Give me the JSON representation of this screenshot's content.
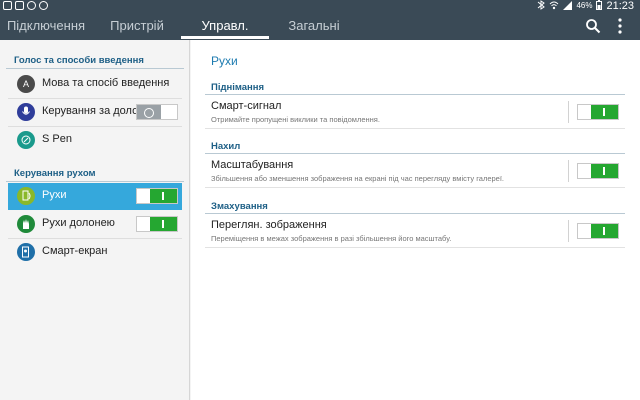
{
  "status_bar": {
    "battery": "46%",
    "time": "21:23"
  },
  "tabs": [
    {
      "label": "Підключення"
    },
    {
      "label": "Пристрій"
    },
    {
      "label": "Управл."
    },
    {
      "label": "Загальні"
    }
  ],
  "active_tab": "Управл.",
  "left_panel": {
    "section1": {
      "header": "Голос та способи введення",
      "items": [
        {
          "label": "Мова та спосіб введення",
          "icon": "keyboard-icon"
        },
        {
          "label": "Керування за долонею",
          "icon": "microphone-icon",
          "toggle": "off"
        },
        {
          "label": "S Pen",
          "icon": "s-pen-icon"
        }
      ]
    },
    "section2": {
      "header": "Керування рухом",
      "items": [
        {
          "label": "Рухи",
          "icon": "motion-icon",
          "toggle": "on",
          "selected": true
        },
        {
          "label": "Рухи долонею",
          "icon": "palm-icon",
          "toggle": "on"
        },
        {
          "label": "Смарт-екран",
          "icon": "smart-screen-icon"
        }
      ]
    }
  },
  "right_panel": {
    "title": "Рухи",
    "sections": [
      {
        "header": "Піднімання",
        "item_title": "Смарт-сигнал",
        "item_sub": "Отримайте пропущені виклики та повідомлення.",
        "toggle": "on"
      },
      {
        "header": "Нахил",
        "item_title": "Масштабування",
        "item_sub": "Збільшення або зменшення зображення на екрані під час перегляду вмісту галереї.",
        "toggle": "on"
      },
      {
        "header": "Змахування",
        "item_title": "Переглян. зображення",
        "item_sub": "Переміщення в межах зображення в разі збільшення його масштабу.",
        "toggle": "on"
      }
    ]
  },
  "colors": {
    "bar": "#3a4a56",
    "accent": "#35a8dc",
    "toggle_on": "#25a731",
    "section_header": "#1d5f86"
  }
}
